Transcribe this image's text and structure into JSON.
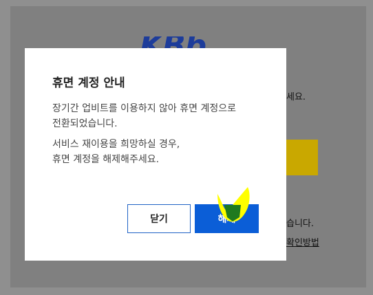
{
  "background": {
    "logo_text": "KBb",
    "side_text_1": "세요.",
    "side_text_2": "습니다.",
    "side_link": "확인방법"
  },
  "dialog": {
    "title": "휴면 계정 안내",
    "paragraph_1": "장기간 업비트를 이용하지 않아 휴면 계정으로\n전환되었습니다.",
    "paragraph_2": "서비스 재이용을 희망하실 경우,\n휴면 계정을 해제해주세요.",
    "close_label": "닫기",
    "release_label": "해제"
  },
  "colors": {
    "overlay": "#808080",
    "primary_button": "#0b5ed7",
    "secondary_border": "#1f62c5",
    "highlight_yellow": "#ffff00",
    "highlight_green": "#1f7a1f"
  }
}
